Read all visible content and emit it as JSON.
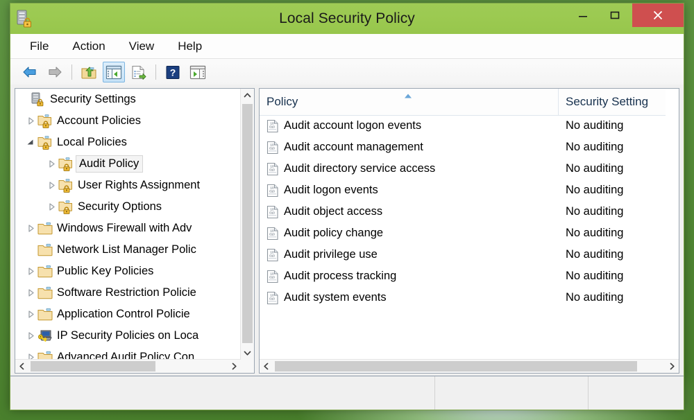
{
  "window": {
    "title": "Local Security Policy",
    "icon": "security-settings-icon",
    "minimize_label": "–",
    "maximize_label": "□",
    "close_label": "×",
    "close_color": "#cf4f4f",
    "titlebar_color": "#9bc950"
  },
  "menubar": {
    "items": [
      {
        "label": "File",
        "name": "menu-file"
      },
      {
        "label": "Action",
        "name": "menu-action"
      },
      {
        "label": "View",
        "name": "menu-view"
      },
      {
        "label": "Help",
        "name": "menu-help"
      }
    ]
  },
  "toolbar": {
    "buttons": [
      {
        "name": "back-button",
        "icon": "back-arrow-icon",
        "state": "enabled"
      },
      {
        "name": "forward-button",
        "icon": "forward-arrow-icon",
        "state": "disabled"
      },
      {
        "name": "up-one-level-button",
        "icon": "up-folder-icon",
        "state": "enabled"
      },
      {
        "name": "show-console-tree-button",
        "icon": "console-tree-icon",
        "state": "active"
      },
      {
        "name": "export-list-button",
        "icon": "export-list-icon",
        "state": "enabled"
      },
      {
        "name": "help-button",
        "icon": "help-question-icon",
        "state": "enabled"
      },
      {
        "name": "show-action-pane-button",
        "icon": "action-pane-icon",
        "state": "enabled"
      }
    ]
  },
  "tree": {
    "items": [
      {
        "label": "Security Settings",
        "indent": 0,
        "twisty": "none",
        "icon": "security-settings-icon",
        "selected": false
      },
      {
        "label": "Account Policies",
        "indent": 1,
        "twisty": "collapsed",
        "icon": "policy-folder-icon",
        "selected": false
      },
      {
        "label": "Local Policies",
        "indent": 1,
        "twisty": "expanded",
        "icon": "policy-folder-icon",
        "selected": false
      },
      {
        "label": "Audit Policy",
        "indent": 2,
        "twisty": "collapsed",
        "icon": "policy-folder-icon",
        "selected": true
      },
      {
        "label": "User Rights Assignment",
        "indent": 2,
        "twisty": "collapsed",
        "icon": "policy-folder-icon",
        "selected": false
      },
      {
        "label": "Security Options",
        "indent": 2,
        "twisty": "collapsed",
        "icon": "policy-folder-icon",
        "selected": false
      },
      {
        "label": "Windows Firewall with Adv",
        "indent": 1,
        "twisty": "collapsed",
        "icon": "folder-icon",
        "selected": false
      },
      {
        "label": "Network List Manager Polic",
        "indent": 1,
        "twisty": "none",
        "icon": "folder-icon",
        "selected": false
      },
      {
        "label": "Public Key Policies",
        "indent": 1,
        "twisty": "collapsed",
        "icon": "folder-icon",
        "selected": false
      },
      {
        "label": "Software Restriction Policie",
        "indent": 1,
        "twisty": "collapsed",
        "icon": "folder-icon",
        "selected": false
      },
      {
        "label": "Application Control Policie",
        "indent": 1,
        "twisty": "collapsed",
        "icon": "folder-icon",
        "selected": false
      },
      {
        "label": "IP Security Policies on Loca",
        "indent": 1,
        "twisty": "collapsed",
        "icon": "ip-security-icon",
        "selected": false
      },
      {
        "label": "Advanced Audit Policy Con",
        "indent": 1,
        "twisty": "collapsed",
        "icon": "folder-icon",
        "selected": false
      }
    ]
  },
  "list": {
    "columns": [
      {
        "label": "Policy",
        "name": "column-header-policy",
        "sort": "ascending"
      },
      {
        "label": "Security Setting",
        "name": "column-header-security-setting",
        "sort": "none"
      }
    ],
    "rows": [
      {
        "policy": "Audit account logon events",
        "setting": "No auditing"
      },
      {
        "policy": "Audit account management",
        "setting": "No auditing"
      },
      {
        "policy": "Audit directory service access",
        "setting": "No auditing"
      },
      {
        "policy": "Audit logon events",
        "setting": "No auditing"
      },
      {
        "policy": "Audit object access",
        "setting": "No auditing"
      },
      {
        "policy": "Audit policy change",
        "setting": "No auditing"
      },
      {
        "policy": "Audit privilege use",
        "setting": "No auditing"
      },
      {
        "policy": "Audit process tracking",
        "setting": "No auditing"
      },
      {
        "policy": "Audit system events",
        "setting": "No auditing"
      }
    ]
  },
  "statusbar": {
    "panel1": "",
    "panel2": "",
    "panel3": ""
  }
}
